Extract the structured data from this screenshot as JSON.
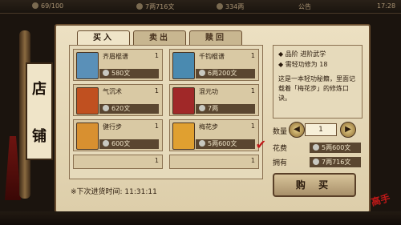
{
  "topbar": {
    "energy": "69/100",
    "money": "7两716文",
    "points": "334两",
    "announcement": "公告",
    "time": "17:28"
  },
  "sign": {
    "char1": "店",
    "char2": "铺"
  },
  "tabs": [
    {
      "label": "买入",
      "active": true
    },
    {
      "label": "卖出",
      "active": false
    },
    {
      "label": "赎回",
      "active": false
    }
  ],
  "items": [
    {
      "name": "齐眉棍谱",
      "count": "1",
      "price": "580文",
      "icon_color": "#5a90b8",
      "selected": false
    },
    {
      "name": "千钧棍谱",
      "count": "1",
      "price": "6两200文",
      "icon_color": "#4a8ab0",
      "selected": false
    },
    {
      "name": "气沉术",
      "count": "1",
      "price": "620文",
      "icon_color": "#c05020",
      "selected": false
    },
    {
      "name": "混元功",
      "count": "1",
      "price": "7两",
      "icon_color": "#a02828",
      "selected": false
    },
    {
      "name": "健行步",
      "count": "1",
      "price": "600文",
      "icon_color": "#d89030",
      "selected": false
    },
    {
      "name": "梅花步",
      "count": "1",
      "price": "5两600文",
      "icon_color": "#e0a030",
      "selected": true
    }
  ],
  "extra_rows": [
    {
      "count": "1"
    },
    {
      "count": "1"
    }
  ],
  "restock": "※下次进货时间: 11:31:11",
  "info": {
    "line1": "◆ 品阶  进阶武学",
    "line2": "◆ 需轻功修为 18",
    "desc": "这是一本轻功秘籍，里面记载着「梅花步」的修炼口诀。"
  },
  "quantity": {
    "label": "数量",
    "value": "1"
  },
  "cost": {
    "label": "花费",
    "value": "5两600文"
  },
  "owned": {
    "label": "拥有",
    "value": "7两716文"
  },
  "buy_button": "购 买",
  "seal_text": "高手"
}
